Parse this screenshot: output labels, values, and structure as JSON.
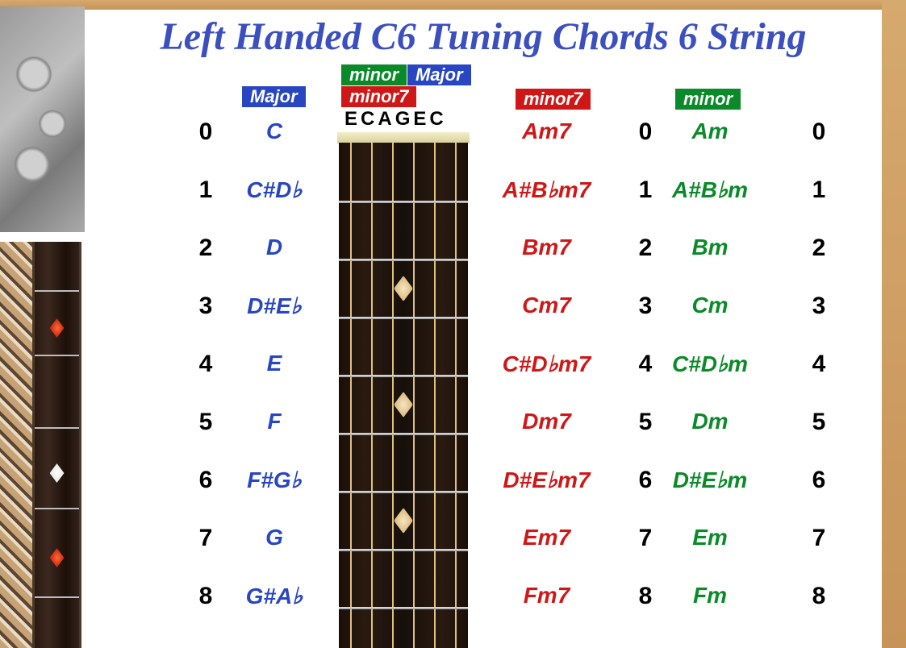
{
  "title": "Left Handed C6 Tuning Chords 6 String",
  "badges": {
    "major": "Major",
    "minor": "minor",
    "minor7": "minor7"
  },
  "tuning": [
    "E",
    "C",
    "A",
    "G",
    "E",
    "C"
  ],
  "chart_data": {
    "type": "table",
    "title": "Left Handed C6 Tuning Chords 6 String",
    "columns": [
      "fret",
      "Major",
      "minor7",
      "minor"
    ],
    "rows": [
      {
        "fret": 0,
        "Major": "C",
        "minor7": "Am7",
        "minor": "Am"
      },
      {
        "fret": 1,
        "Major": "C#D♭",
        "minor7": "A#B♭m7",
        "minor": "A#B♭m"
      },
      {
        "fret": 2,
        "Major": "D",
        "minor7": "Bm7",
        "minor": "Bm"
      },
      {
        "fret": 3,
        "Major": "D#E♭",
        "minor7": "Cm7",
        "minor": "Cm"
      },
      {
        "fret": 4,
        "Major": "E",
        "minor7": "C#D♭m7",
        "minor": "C#D♭m"
      },
      {
        "fret": 5,
        "Major": "F",
        "minor7": "Dm7",
        "minor": "Dm"
      },
      {
        "fret": 6,
        "Major": "F#G♭",
        "minor7": "D#E♭m7",
        "minor": "D#E♭m"
      },
      {
        "fret": 7,
        "Major": "G",
        "minor7": "Em7",
        "minor": "Em"
      },
      {
        "fret": 8,
        "Major": "G#A♭",
        "minor7": "Fm7",
        "minor": "Fm"
      }
    ]
  }
}
